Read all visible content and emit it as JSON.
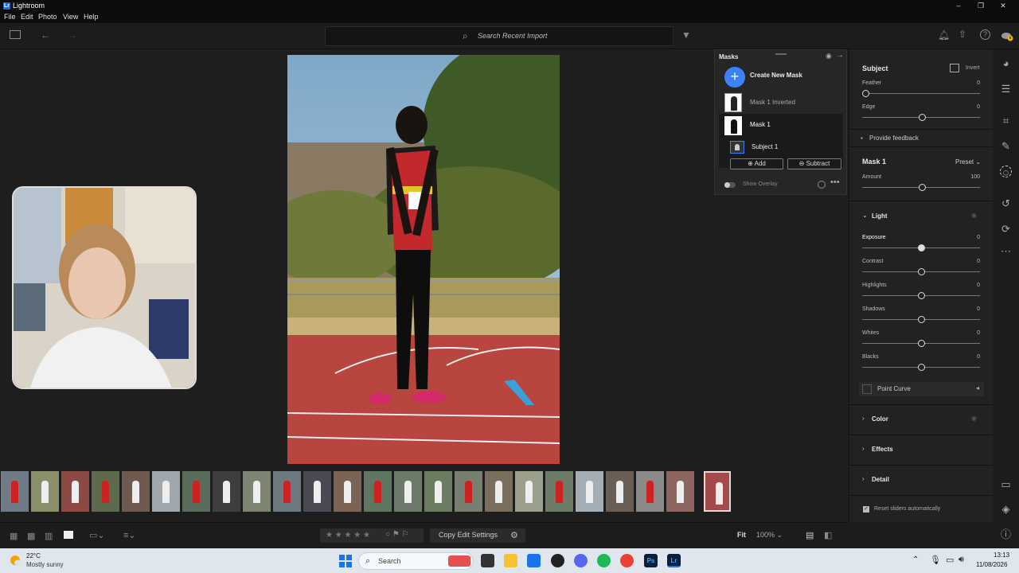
{
  "app": {
    "title": "Lightroom",
    "icon_label": "Lr"
  },
  "window_controls": [
    "–",
    "❐",
    "✕"
  ],
  "menu": [
    "File",
    "Edit",
    "Photo",
    "View",
    "Help"
  ],
  "search": {
    "placeholder": "Search Recent Import"
  },
  "masks_panel": {
    "title": "Masks",
    "create_label": "Create New Mask",
    "items": [
      {
        "label": "Mask 1 Inverted"
      },
      {
        "label": "Mask 1"
      },
      {
        "label": "Subject 1"
      }
    ],
    "add_label": "Add",
    "subtract_label": "Subtract",
    "show_overlay_label": "Show Overlay"
  },
  "edit_panel": {
    "subject": {
      "title": "Subject",
      "invert_label": "Invert",
      "feather": {
        "label": "Feather",
        "value": "0",
        "level": 0
      },
      "edge": {
        "label": "Edge",
        "value": "0",
        "level": 0.5
      }
    },
    "feedback_label": "Provide feedback",
    "mask": {
      "title": "Mask 1",
      "preset_label": "Preset",
      "amount": {
        "label": "Amount",
        "value": "100",
        "level": 0.5
      }
    },
    "light": {
      "title": "Light",
      "sliders": [
        {
          "label": "Exposure",
          "value": "0",
          "level": 0.5
        },
        {
          "label": "Contrast",
          "value": "0",
          "level": 0.5
        },
        {
          "label": "Highlights",
          "value": "0",
          "level": 0.5
        },
        {
          "label": "Shadows",
          "value": "0",
          "level": 0.5
        },
        {
          "label": "Whites",
          "value": "0",
          "level": 0.5
        },
        {
          "label": "Blacks",
          "value": "0",
          "level": 0.5
        }
      ],
      "point_curve_label": "Point Curve"
    },
    "sections": [
      "Color",
      "Effects",
      "Detail"
    ],
    "reset_label": "Reset sliders automatically"
  },
  "bottom_bar": {
    "copy_label": "Copy Edit Settings",
    "fit_label": "Fit",
    "zoom_label": "100%",
    "stars": "★ ★ ★ ★ ★"
  },
  "taskbar": {
    "weather_temp": "22°C",
    "weather_desc": "Mostly sunny",
    "search_label": "Search",
    "time": "13:13",
    "date": "11/08/2026"
  },
  "colors": {
    "accent": "#3b82f6",
    "track_red": "#b53b3b",
    "panel": "#222222"
  }
}
